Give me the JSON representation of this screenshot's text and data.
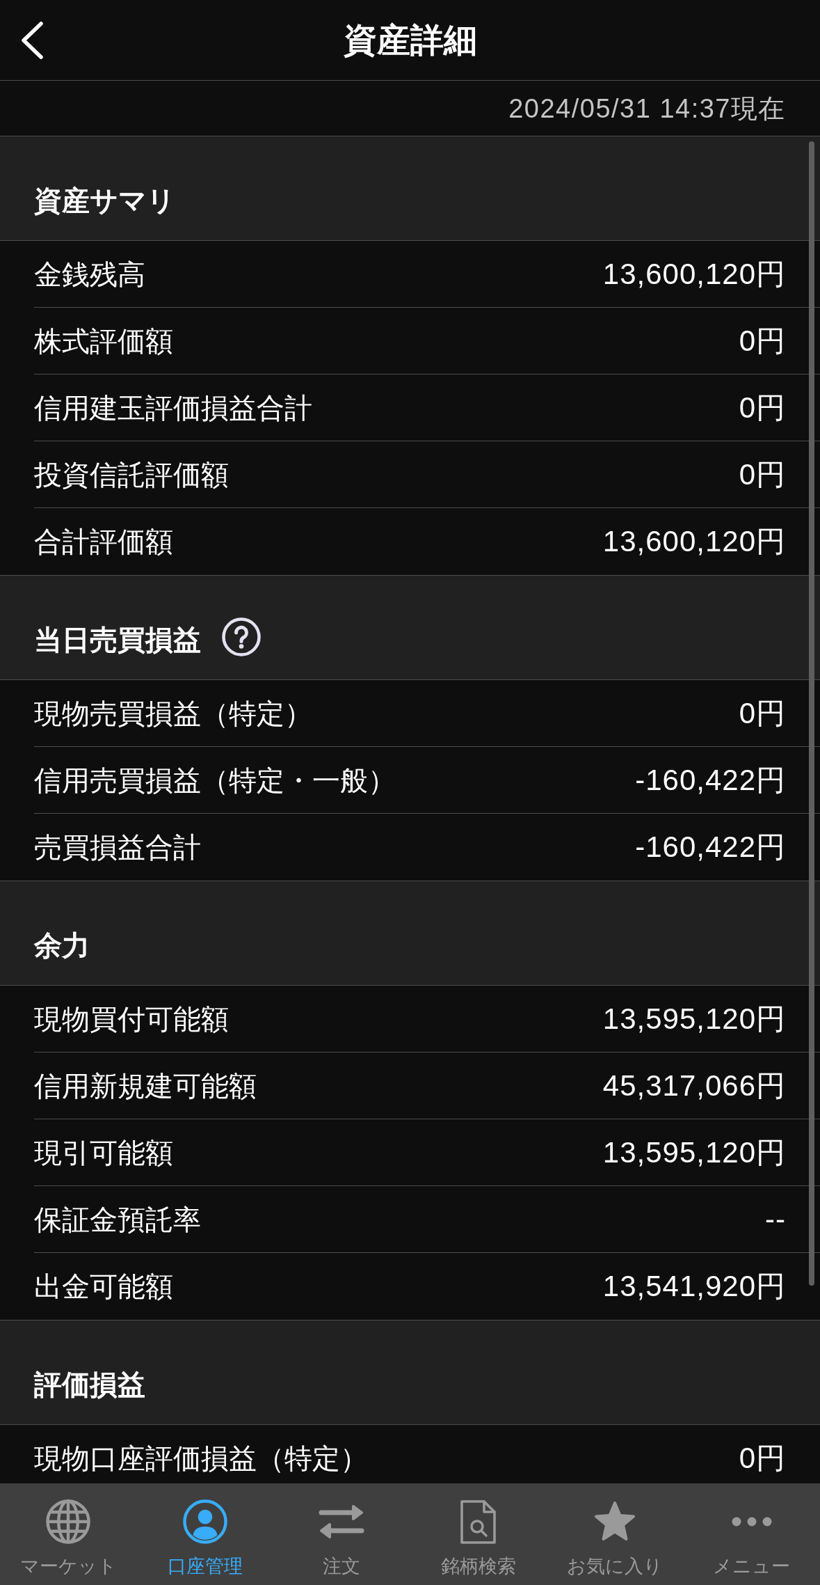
{
  "header": {
    "title": "資産詳細"
  },
  "timestamp": "2024/05/31 14:37現在",
  "sections": [
    {
      "title": "資産サマリ",
      "help": false,
      "rows": [
        {
          "label": "金銭残高",
          "value": "13,600,120円"
        },
        {
          "label": "株式評価額",
          "value": "0円"
        },
        {
          "label": "信用建玉評価損益合計",
          "value": "0円"
        },
        {
          "label": "投資信託評価額",
          "value": "0円"
        },
        {
          "label": "合計評価額",
          "value": "13,600,120円"
        }
      ]
    },
    {
      "title": "当日売買損益",
      "help": true,
      "rows": [
        {
          "label": "現物売買損益（特定）",
          "value": "0円"
        },
        {
          "label": "信用売買損益（特定・一般）",
          "value": "-160,422円"
        },
        {
          "label": "売買損益合計",
          "value": "-160,422円"
        }
      ]
    },
    {
      "title": "余力",
      "help": false,
      "rows": [
        {
          "label": "現物買付可能額",
          "value": "13,595,120円"
        },
        {
          "label": "信用新規建可能額",
          "value": "45,317,066円"
        },
        {
          "label": "現引可能額",
          "value": "13,595,120円"
        },
        {
          "label": "保証金預託率",
          "value": "--"
        },
        {
          "label": "出金可能額",
          "value": "13,541,920円"
        }
      ]
    },
    {
      "title": "評価損益",
      "help": false,
      "rows": [
        {
          "label": "現物口座評価損益（特定）",
          "value": "0円"
        }
      ]
    }
  ],
  "bottom_nav": [
    {
      "label": "マーケット",
      "selected": false
    },
    {
      "label": "口座管理",
      "selected": true
    },
    {
      "label": "注文",
      "selected": false
    },
    {
      "label": "銘柄検索",
      "selected": false
    },
    {
      "label": "お気に入り",
      "selected": false
    },
    {
      "label": "メニュー",
      "selected": false
    }
  ]
}
